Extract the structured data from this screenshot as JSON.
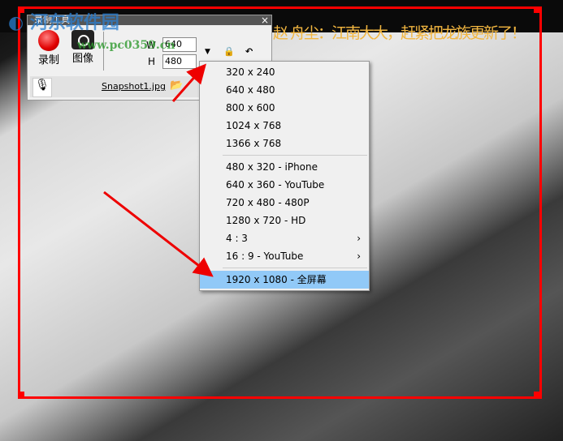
{
  "ticker": "赵 舟尘：江南大大，赶紧把龙族更新了！",
  "watermark": {
    "name": "河东软件园",
    "url": "www.pc0359.cn"
  },
  "window": {
    "title": "录制工具",
    "close": "×",
    "record_label": "录制",
    "image_label": "图像",
    "w_label": "W",
    "h_label": "H",
    "w_value": "640",
    "h_value": "480",
    "filename": "Snapshot1.jpg"
  },
  "menu": {
    "group1": [
      "320 x 240",
      "640 x 480",
      "800 x 600",
      "1024 x 768",
      "1366 x 768"
    ],
    "group2": [
      "480 x 320 - iPhone",
      "640 x 360 - YouTube",
      "720 x 480 - 480P",
      "1280 x 720 - HD",
      "4 : 3",
      "16 : 9 - YouTube"
    ],
    "submenu_arrow": "›",
    "selected": "1920 x 1080 - 全屏幕"
  },
  "colors": {
    "frame": "#ff0000",
    "highlight": "#91c9f7",
    "ticker": "#f2b640"
  }
}
